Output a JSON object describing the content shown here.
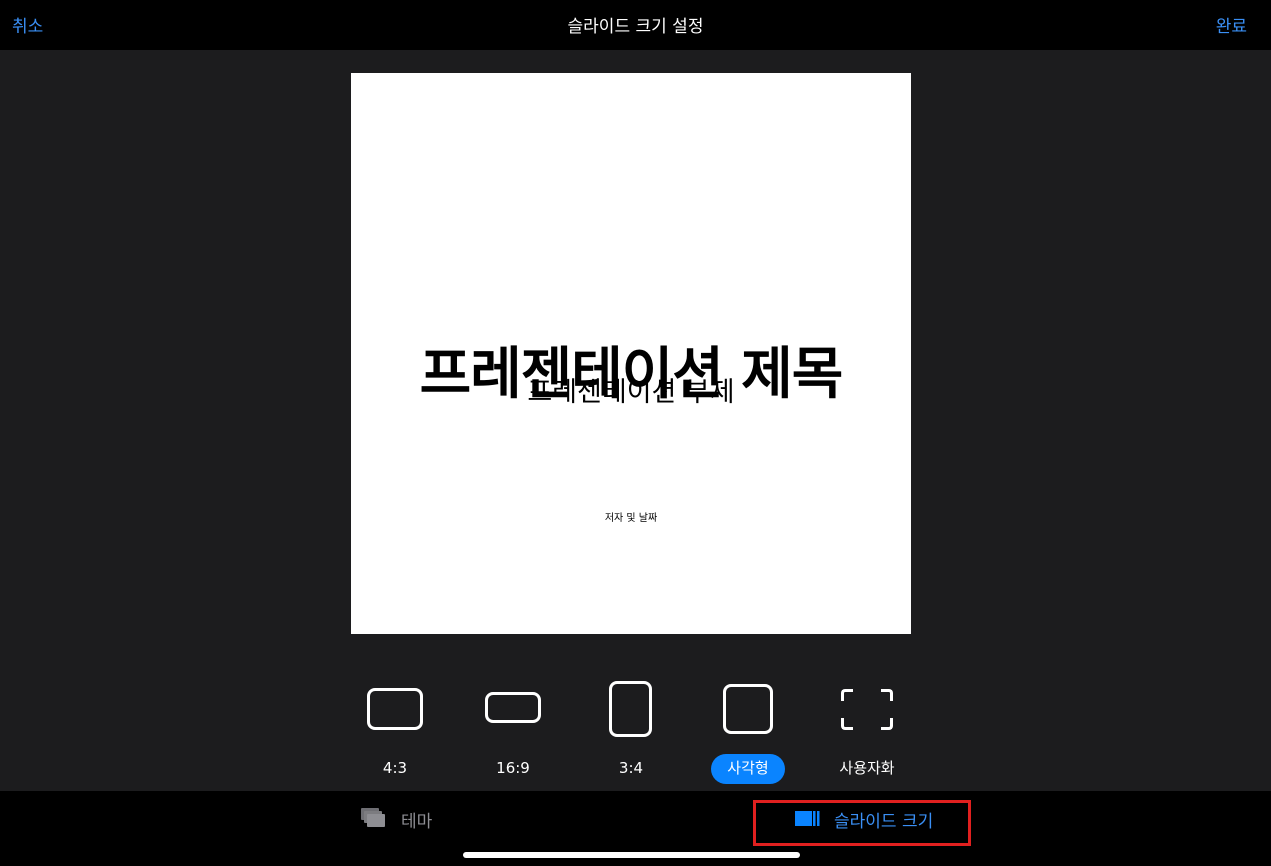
{
  "nav": {
    "cancel_label": "취소",
    "title": "슬라이드 크기 설정",
    "done_label": "완료"
  },
  "slide": {
    "title": "프레젠테이션 제목",
    "subtitle": "프레젠테이션 부제",
    "author": "저자 및 날짜"
  },
  "size_options": [
    {
      "label": "4:3",
      "icon": "landscape-4-3-icon",
      "selected": false
    },
    {
      "label": "16:9",
      "icon": "widescreen-16-9-icon",
      "selected": false
    },
    {
      "label": "3:4",
      "icon": "portrait-3-4-icon",
      "selected": false
    },
    {
      "label": "사각형",
      "icon": "square-icon",
      "selected": true
    },
    {
      "label": "사용자화",
      "icon": "custom-size-icon",
      "selected": false
    }
  ],
  "tabs": {
    "theme_label": "테마",
    "slide_size_label": "슬라이드 크기",
    "active": "slide_size"
  },
  "colors": {
    "accent": "#0a84ff",
    "highlight": "#e0201f",
    "background": "#1c1c1e",
    "bar": "#000000"
  }
}
